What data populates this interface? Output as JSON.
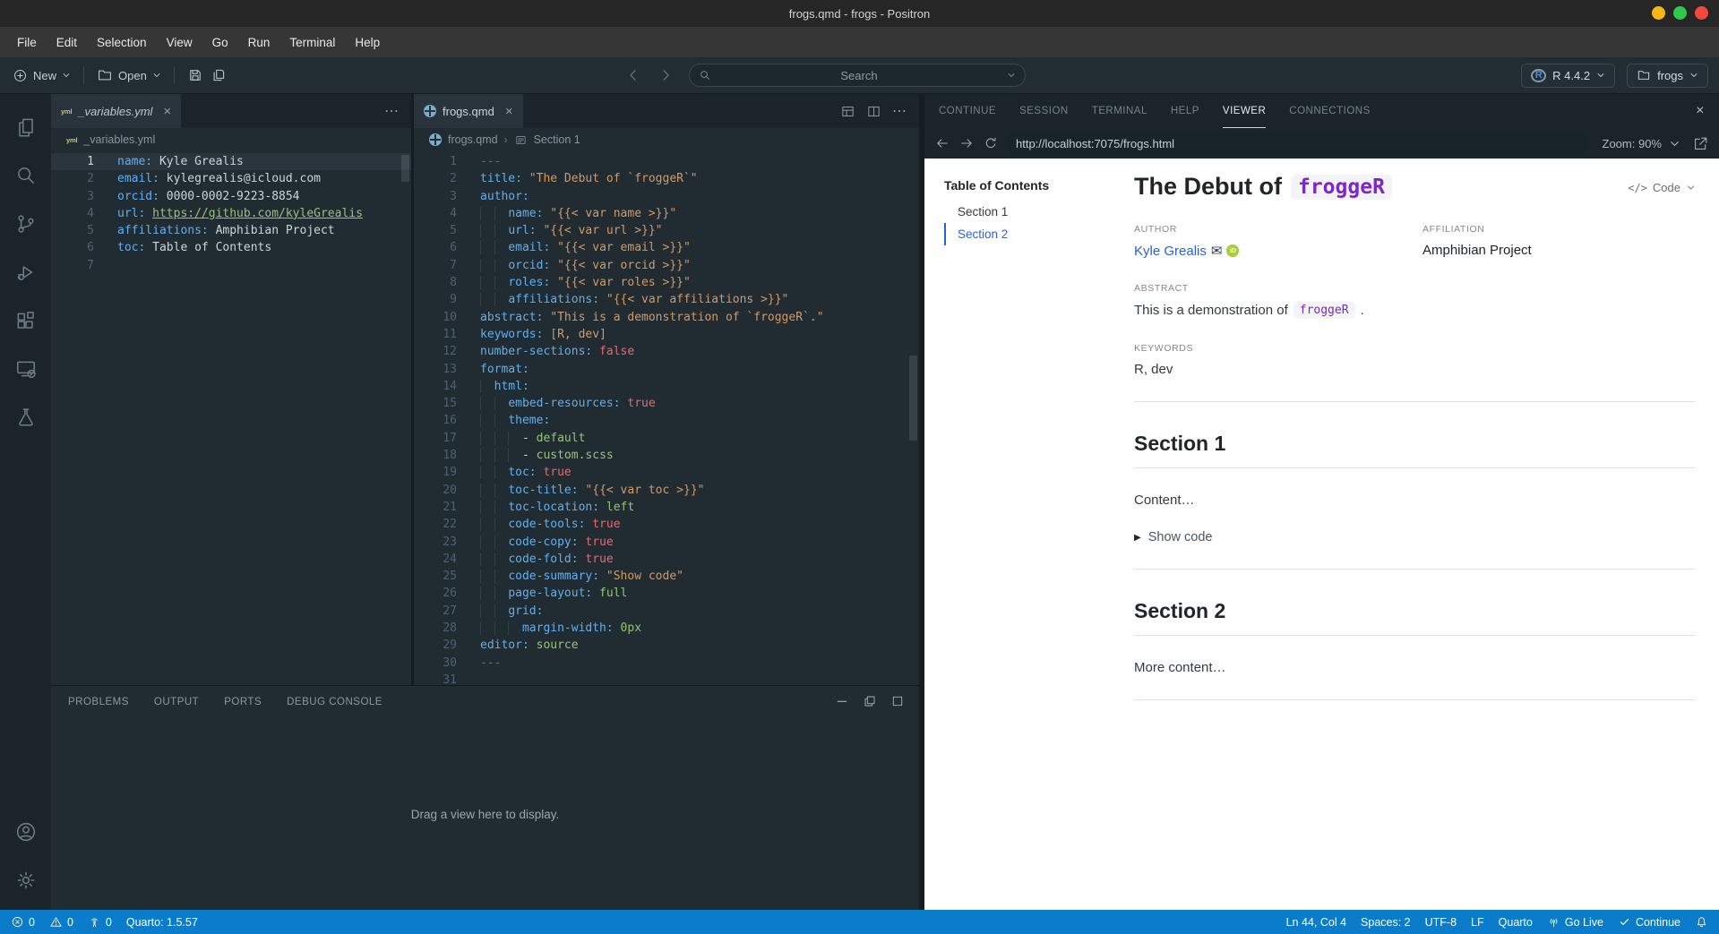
{
  "window": {
    "title": "frogs.qmd - frogs - Positron"
  },
  "traffic_colors": {
    "minimize": "#f5b714",
    "maximize": "#30c94e",
    "close": "#f5483d"
  },
  "menu": [
    "File",
    "Edit",
    "Selection",
    "View",
    "Go",
    "Run",
    "Terminal",
    "Help"
  ],
  "toolbar": {
    "new_label": "New",
    "open_label": "Open",
    "search_placeholder": "Search",
    "r_runtime": "R 4.4.2",
    "project_name": "frogs"
  },
  "activity": {
    "top": [
      "explorer-icon",
      "search-icon",
      "source-control-icon",
      "run-debug-icon",
      "extensions-icon",
      "remote-explorer-icon",
      "testing-icon"
    ],
    "bottom": [
      "account-icon",
      "settings-icon"
    ]
  },
  "editors": {
    "left": {
      "tab": "_variables.yml",
      "breadcrumb": [
        "_variables.yml"
      ],
      "active_line": 1,
      "lines": [
        {
          "t": [
            [
              "k",
              "name:"
            ],
            [
              "t",
              " Kyle Grealis"
            ]
          ]
        },
        {
          "t": [
            [
              "k",
              "email:"
            ],
            [
              "t",
              " kylegrealis@icloud.com"
            ]
          ]
        },
        {
          "t": [
            [
              "k",
              "orcid:"
            ],
            [
              "t",
              " 0000-0002-9223-8854"
            ]
          ]
        },
        {
          "t": [
            [
              "k",
              "url:"
            ],
            [
              "t",
              " "
            ],
            [
              "lk",
              "https://github.com/kyleGrealis"
            ]
          ]
        },
        {
          "t": [
            [
              "k",
              "affiliations:"
            ],
            [
              "t",
              " Amphibian Project"
            ]
          ]
        },
        {
          "t": [
            [
              "k",
              "toc:"
            ],
            [
              "t",
              " Table of Contents"
            ]
          ]
        },
        {
          "t": []
        }
      ]
    },
    "right": {
      "tab": "frogs.qmd",
      "breadcrumb": [
        "frogs.qmd",
        "Section 1"
      ],
      "lines": [
        {
          "t": [
            [
              "c",
              "---"
            ]
          ]
        },
        {
          "t": [
            [
              "k",
              "title:"
            ],
            [
              "s",
              " \"The Debut of `froggeR`\""
            ]
          ]
        },
        {
          "t": [
            [
              "k",
              "author:"
            ]
          ]
        },
        {
          "i": 4,
          "t": [
            [
              "k",
              "name:"
            ],
            [
              "s",
              " \"{{< var name >}}\""
            ]
          ]
        },
        {
          "i": 4,
          "t": [
            [
              "k",
              "url:"
            ],
            [
              "s",
              " \"{{< var url >}}\""
            ]
          ]
        },
        {
          "i": 4,
          "t": [
            [
              "k",
              "email:"
            ],
            [
              "s",
              " \"{{< var email >}}\""
            ]
          ]
        },
        {
          "i": 4,
          "t": [
            [
              "k",
              "orcid:"
            ],
            [
              "s",
              " \"{{< var orcid >}}\""
            ]
          ]
        },
        {
          "i": 4,
          "t": [
            [
              "k",
              "roles:"
            ],
            [
              "s",
              " \"{{< var roles >}}\""
            ]
          ]
        },
        {
          "i": 4,
          "t": [
            [
              "k",
              "affiliations:"
            ],
            [
              "s",
              " \"{{< var affiliations >}}\""
            ]
          ]
        },
        {
          "t": [
            [
              "k",
              "abstract:"
            ],
            [
              "s",
              " \"This is a demonstration of `froggeR`.\""
            ]
          ]
        },
        {
          "t": [
            [
              "k",
              "keywords:"
            ],
            [
              "s",
              " [R, dev]"
            ]
          ]
        },
        {
          "t": [
            [
              "k",
              "number-sections:"
            ],
            [
              "b",
              " false"
            ]
          ]
        },
        {
          "t": [
            [
              "k",
              "format:"
            ]
          ]
        },
        {
          "i": 2,
          "t": [
            [
              "k",
              "html:"
            ]
          ]
        },
        {
          "i": 4,
          "t": [
            [
              "k",
              "embed-resources:"
            ],
            [
              "b",
              " true"
            ]
          ]
        },
        {
          "i": 4,
          "t": [
            [
              "k",
              "theme:"
            ]
          ]
        },
        {
          "i": 6,
          "t": [
            [
              "t",
              "- "
            ],
            [
              "v",
              "default"
            ]
          ]
        },
        {
          "i": 6,
          "t": [
            [
              "t",
              "- "
            ],
            [
              "v",
              "custom.scss"
            ]
          ]
        },
        {
          "i": 4,
          "t": [
            [
              "k",
              "toc:"
            ],
            [
              "b",
              " true"
            ]
          ]
        },
        {
          "i": 4,
          "t": [
            [
              "k",
              "toc-title:"
            ],
            [
              "s",
              " \"{{< var toc >}}\""
            ]
          ]
        },
        {
          "i": 4,
          "t": [
            [
              "k",
              "toc-location:"
            ],
            [
              "v",
              " left"
            ]
          ]
        },
        {
          "i": 4,
          "t": [
            [
              "k",
              "code-tools:"
            ],
            [
              "b",
              " true"
            ]
          ]
        },
        {
          "i": 4,
          "t": [
            [
              "k",
              "code-copy:"
            ],
            [
              "b",
              " true"
            ]
          ]
        },
        {
          "i": 4,
          "t": [
            [
              "k",
              "code-fold:"
            ],
            [
              "b",
              " true"
            ]
          ]
        },
        {
          "i": 4,
          "t": [
            [
              "k",
              "code-summary:"
            ],
            [
              "s",
              " \"Show code\""
            ]
          ]
        },
        {
          "i": 4,
          "t": [
            [
              "k",
              "page-layout:"
            ],
            [
              "v",
              " full"
            ]
          ]
        },
        {
          "i": 4,
          "t": [
            [
              "k",
              "grid:"
            ]
          ]
        },
        {
          "i": 6,
          "t": [
            [
              "k",
              "margin-width:"
            ],
            [
              "v",
              " 0px"
            ]
          ]
        },
        {
          "t": [
            [
              "k",
              "editor:"
            ],
            [
              "v",
              " source"
            ]
          ]
        },
        {
          "t": [
            [
              "c",
              "---"
            ]
          ]
        },
        {
          "t": []
        }
      ]
    }
  },
  "bottom_panel": {
    "tabs": [
      "PROBLEMS",
      "OUTPUT",
      "PORTS",
      "DEBUG CONSOLE"
    ],
    "placeholder": "Drag a view here to display."
  },
  "right_panel": {
    "tabs": [
      "CONTINUE",
      "SESSION",
      "TERMINAL",
      "HELP",
      "VIEWER",
      "CONNECTIONS"
    ],
    "active_tab": "VIEWER",
    "nav": {
      "url": "http://localhost:7075/frogs.html",
      "zoom_label": "Zoom: 90%"
    },
    "viewer": {
      "toc_title": "Table of Contents",
      "toc": [
        {
          "label": "Section 1",
          "active": false
        },
        {
          "label": "Section 2",
          "active": true
        }
      ],
      "title_text": "The Debut of",
      "title_code": "froggeR",
      "code_button_label": "Code",
      "author_label": "AUTHOR",
      "author_name": "Kyle Grealis",
      "affiliation_label": "AFFILIATION",
      "affiliation": "Amphibian Project",
      "abstract_label": "ABSTRACT",
      "abstract_text": "This is a demonstration of",
      "abstract_code": "froggeR",
      "abstract_period": ".",
      "keywords_label": "KEYWORDS",
      "keywords": "R, dev",
      "sections": [
        {
          "heading": "Section 1",
          "body": "Content…",
          "details": "Show code"
        },
        {
          "heading": "Section 2",
          "body": "More content…"
        }
      ]
    }
  },
  "status": {
    "left": [
      {
        "icon": "error-icon",
        "label": "0",
        "name": "error-count"
      },
      {
        "icon": "warning-icon",
        "label": "0",
        "name": "warning-count"
      },
      {
        "icon": "radio-tower-icon",
        "label": "0",
        "name": "ports-count"
      },
      {
        "label": "Quarto: 1.5.57",
        "name": "quarto-version"
      }
    ],
    "right": [
      {
        "label": "Ln 44, Col 4",
        "name": "cursor-position"
      },
      {
        "label": "Spaces: 2",
        "name": "indentation"
      },
      {
        "label": "UTF-8",
        "name": "encoding"
      },
      {
        "label": "LF",
        "name": "eol"
      },
      {
        "label": "Quarto",
        "name": "language-mode"
      },
      {
        "icon": "broadcast-icon",
        "label": "Go Live",
        "name": "go-live"
      },
      {
        "icon": "check-icon",
        "label": "Continue",
        "name": "continue-status"
      },
      {
        "icon": "bell-icon",
        "label": "",
        "name": "notifications"
      }
    ]
  },
  "colors": {
    "status_bar": "#0b7cca",
    "link": "#2761e3",
    "inline_code": "#7d26c9",
    "orcid": "#a6ce39"
  }
}
